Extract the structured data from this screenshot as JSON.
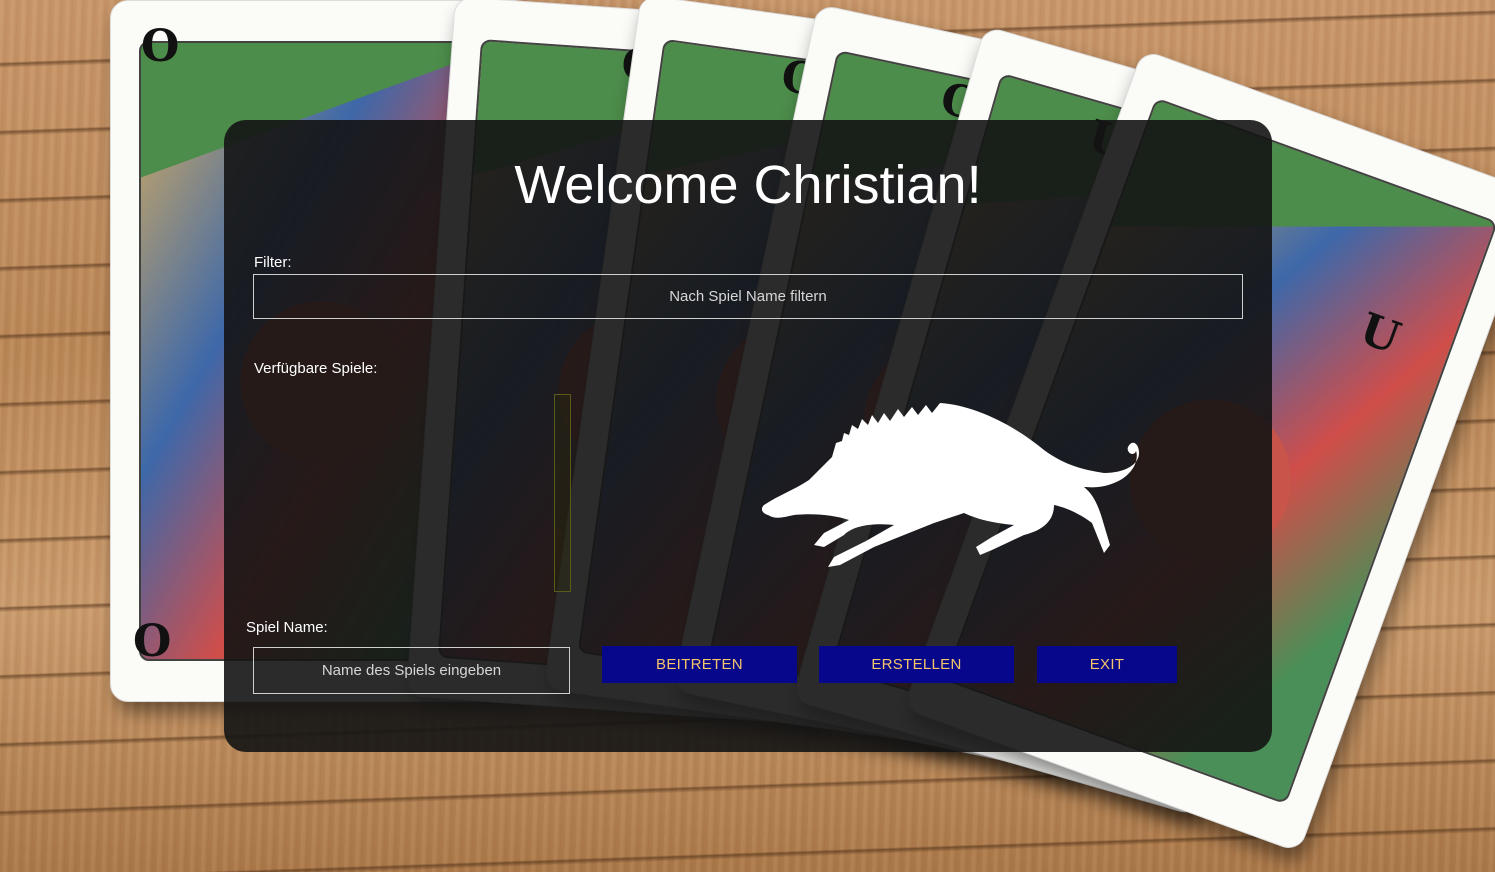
{
  "title": "Welcome Christian!",
  "filter": {
    "label": "Filter:",
    "placeholder": "Nach Spiel Name filtern"
  },
  "games": {
    "label": "Verfügbare Spiele:",
    "items": []
  },
  "game_name": {
    "label": "Spiel Name:",
    "placeholder": "Name des Spiels eingeben"
  },
  "buttons": {
    "join": "BEITRETEN",
    "create": "ERSTELLEN",
    "exit": "EXIT"
  },
  "card_indices": [
    "O",
    "O",
    "O",
    "O",
    "U",
    "U"
  ],
  "colors": {
    "panel": "#141414",
    "button_bg": "#07078c",
    "button_text": "#f5c56a",
    "text": "#ffffff"
  }
}
